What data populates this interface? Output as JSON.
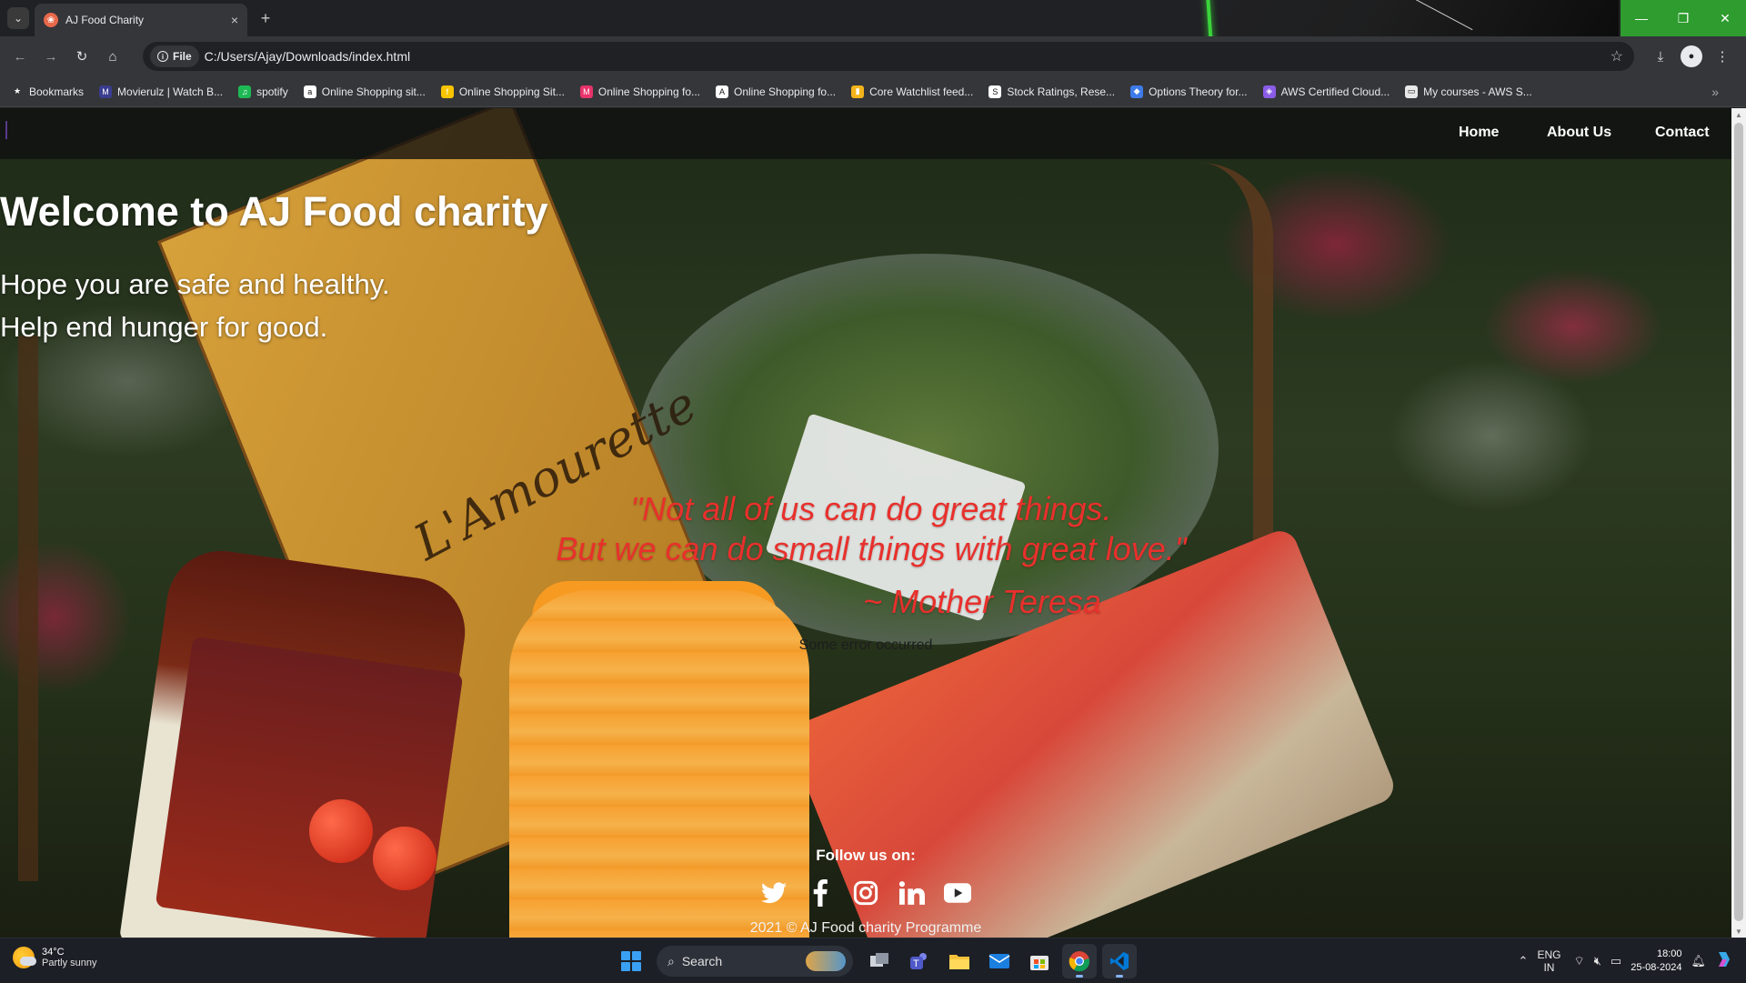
{
  "browser": {
    "tab_title": "AJ Food Charity",
    "tab_close": "×",
    "new_tab": "+",
    "tab_list": "⌄",
    "site_chip": "File",
    "url": "C:/Users/Ajay/Downloads/index.html",
    "bookmarks": [
      {
        "label": "Bookmarks",
        "icon": "star-icon",
        "glyph": "★",
        "color": "#35363a"
      },
      {
        "label": "Movierulz | Watch B...",
        "icon": "movierulz-icon",
        "glyph": "M",
        "color": "#3a3d8f"
      },
      {
        "label": "spotify",
        "icon": "spotify-icon",
        "glyph": "♫",
        "color": "#1db954"
      },
      {
        "label": "Online Shopping sit...",
        "icon": "amazon-icon",
        "glyph": "a",
        "color": "#ffffff"
      },
      {
        "label": "Online Shopping Sit...",
        "icon": "flipkart-icon",
        "glyph": "f",
        "color": "#f7c400"
      },
      {
        "label": "Online Shopping fo...",
        "icon": "myntra-icon",
        "glyph": "M",
        "color": "#e8336b"
      },
      {
        "label": "Online Shopping fo...",
        "icon": "ajio-icon",
        "glyph": "A",
        "color": "#ffffff"
      },
      {
        "label": "Core Watchlist feed...",
        "icon": "chart-bars-icon",
        "glyph": "▮",
        "color": "#f3b41b"
      },
      {
        "label": "Stock Ratings, Rese...",
        "icon": "stock-ratings-icon",
        "glyph": "S",
        "color": "#ffffff"
      },
      {
        "label": "Options Theory for...",
        "icon": "shield-icon",
        "glyph": "◆",
        "color": "#3e7be8"
      },
      {
        "label": "AWS Certified Cloud...",
        "icon": "aws-cube-icon",
        "glyph": "◈",
        "color": "#8a5ce8"
      },
      {
        "label": "My courses - AWS S...",
        "icon": "courses-icon",
        "glyph": "▭",
        "color": "#e8e8e8"
      }
    ],
    "bookmarks_overflow": "»"
  },
  "site": {
    "nav": {
      "home": "Home",
      "about": "About Us",
      "contact": "Contact"
    },
    "hero": {
      "title": "Welcome to AJ Food charity",
      "line1": "Hope you are safe and healthy.",
      "line2": "Help end hunger for good."
    },
    "quote": {
      "line1": "\"Not all of us can do great things.",
      "line2": "But we can do small things with great love.\"",
      "author": "~ Mother Teresa"
    },
    "error": "Some error occurred",
    "footer": {
      "follow": "Follow us on:",
      "copyright": "2021 © AJ Food charity Programme",
      "social": [
        "twitter-icon",
        "facebook-icon",
        "instagram-icon",
        "linkedin-icon",
        "youtube-icon"
      ]
    },
    "quote_color": "#e8302c"
  },
  "taskbar": {
    "weather_temp": "34°C",
    "weather_desc": "Partly sunny",
    "search_label": "Search",
    "lang_top": "ENG",
    "lang_bottom": "IN",
    "time": "18:00",
    "date": "25-08-2024",
    "apps": [
      "task-view-icon",
      "teams-icon",
      "file-explorer-icon",
      "mail-icon",
      "store-icon",
      "chrome-icon",
      "vscode-icon"
    ]
  }
}
